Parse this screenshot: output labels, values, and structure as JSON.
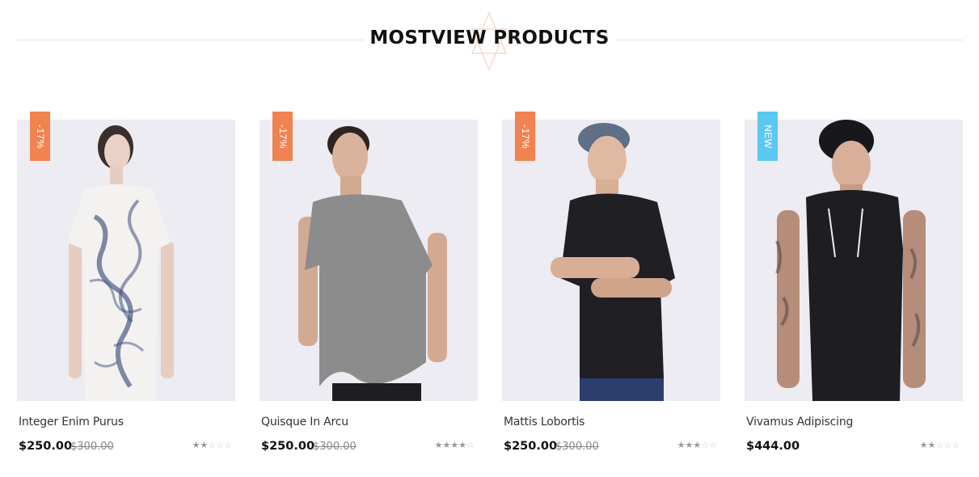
{
  "section": {
    "title": "MOSTVIEW PRODUCTS"
  },
  "products": [
    {
      "name": "Integer Enim Purus",
      "price": "$250.00",
      "old_price": "$300.00",
      "badge": "-17%",
      "badge_type": "sale",
      "rating": 2,
      "rating_max": 5
    },
    {
      "name": "Quisque In Arcu",
      "price": "$250.00",
      "old_price": "$300.00",
      "badge": "-17%",
      "badge_type": "sale",
      "rating": 4,
      "rating_max": 5
    },
    {
      "name": "Mattis Lobortis",
      "price": "$250.00",
      "old_price": "$300.00",
      "badge": "-17%",
      "badge_type": "sale",
      "rating": 3,
      "rating_max": 5
    },
    {
      "name": "Vivamus Adipiscing",
      "price": "$444.00",
      "old_price": "",
      "badge": "NEW",
      "badge_type": "new",
      "rating": 2,
      "rating_max": 5
    }
  ],
  "colors": {
    "sale_badge": "#f0834f",
    "new_badge": "#5bc8f2",
    "image_bg": "#ececf2",
    "accent_star": "#f6c6a8"
  }
}
